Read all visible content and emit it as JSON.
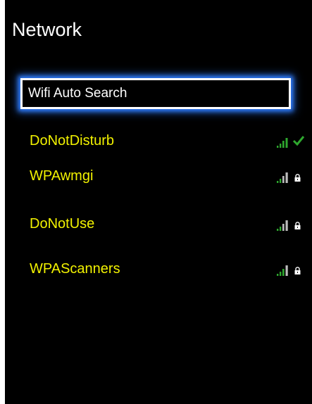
{
  "screen": {
    "title": "Network"
  },
  "search": {
    "label": "Wifi Auto Search"
  },
  "networks": [
    {
      "name": "DoNotDisturb",
      "status": "connected",
      "signal_color": "#2ea82e"
    },
    {
      "name": "WPAwmgi",
      "status": "locked",
      "signal_color": "#2ea82e"
    },
    {
      "name": "DoNotUse",
      "status": "locked",
      "signal_color": "#2ea82e"
    },
    {
      "name": "WPAScanners",
      "status": "locked",
      "signal_color": "#2ea82e"
    }
  ],
  "colors": {
    "background": "#000000",
    "network_text": "#f2f200",
    "focus_glow": "#2f7dff",
    "signal_active": "#2ea82e",
    "signal_inactive": "#bdbdbd"
  },
  "icons": {
    "signal": "wifi-signal-bars-icon",
    "connected": "checkmark-icon",
    "secured": "lock-icon"
  }
}
